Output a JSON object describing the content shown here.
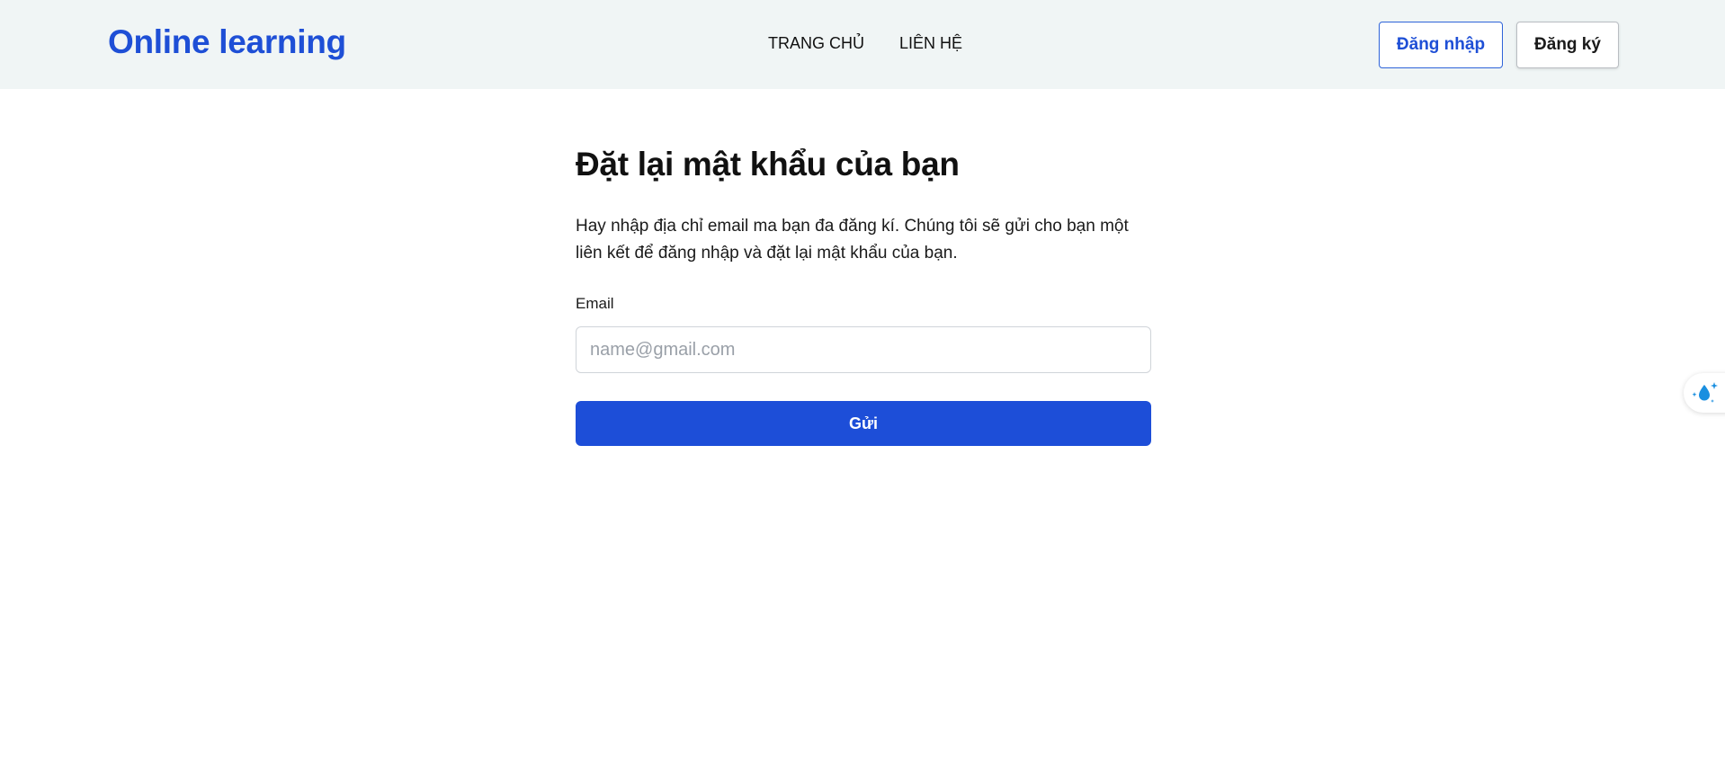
{
  "header": {
    "brand": "Online learning",
    "nav": [
      {
        "label": "TRANG CHỦ"
      },
      {
        "label": "LIÊN HỆ"
      }
    ],
    "login_label": "Đăng nhập",
    "register_label": "Đăng ký"
  },
  "form": {
    "title": "Đặt lại mật khẩu của bạn",
    "description": "Hay nhập địa chỉ email ma bạn đa đăng kí. Chúng tôi sẽ gửi cho bạn một liên kết để đăng nhập và đặt lại mật khẩu của bạn.",
    "email_label": "Email",
    "email_value": "",
    "email_placeholder": "name@gmail.com",
    "submit_label": "Gửi"
  },
  "widget": {
    "icon": "water-drop-sparkle-icon"
  },
  "colors": {
    "brand": "#1e4fd6",
    "header_bg": "#f0f5f5",
    "primary_button": "#1d4ed8",
    "widget_icon": "#1a8fe0"
  }
}
